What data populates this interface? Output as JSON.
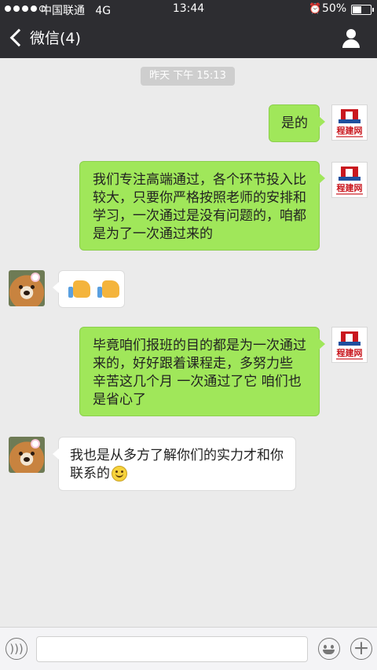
{
  "status_bar": {
    "carrier": "中国联通",
    "network": "4G",
    "time": "13:44",
    "battery": "50%",
    "battery_level": 0.5
  },
  "nav": {
    "back_label": "微信(4)",
    "title": "",
    "right_icon": "person-icon"
  },
  "timestamp": "昨天 下午 15:13",
  "messages": [
    {
      "side": "right",
      "sender": "程建网",
      "text": "是的"
    },
    {
      "side": "right",
      "sender": "程建网",
      "text": "我们专注高端通过，各个环节投入比较大，只要你严格按照老师的安排和学习，一次通过是没有问题的，咱都是为了一次通过来的"
    },
    {
      "side": "left",
      "content": [
        "thumbs-up-icon",
        "thumbs-up-icon"
      ]
    },
    {
      "side": "right",
      "sender": "程建网",
      "text": "毕竟咱们报班的目的都是为一次通过来的，好好跟着课程走，多努力些 辛苦这几个月 一次通过了它 咱们也是省心了"
    },
    {
      "side": "left",
      "text": "我也是从多方了解你们的实力才和你联系的",
      "emoji": "smiley-icon"
    }
  ],
  "input_bar": {
    "left_icon": "voice-icon",
    "right_icons": [
      "emoji-icon",
      "plus-icon"
    ]
  },
  "colors": {
    "nav_bg": "#2d2d31",
    "chat_bg": "#ebebeb",
    "bubble_mine": "#a0e75a",
    "bubble_other": "#ffffff"
  }
}
